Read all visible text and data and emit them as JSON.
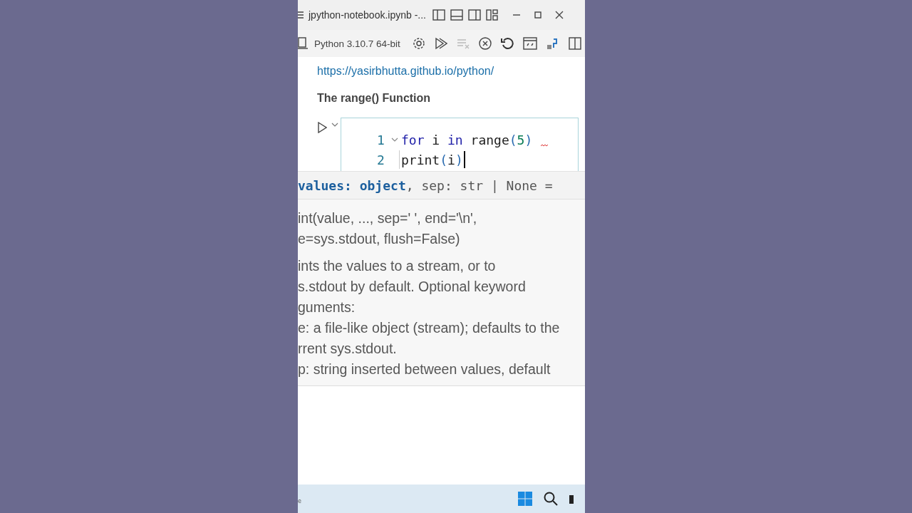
{
  "window": {
    "title": "jpython-notebook.ipynb -..."
  },
  "toolbar": {
    "kernel": "Python 3.10.7 64-bit"
  },
  "notebook": {
    "link": "https://yasirbhutta.github.io/python/",
    "heading": "The range() Function",
    "cell": {
      "lines": [
        {
          "number": "1",
          "tokens": [
            {
              "kind": "keyword",
              "text": "for"
            },
            {
              "kind": "plain",
              "text": " i "
            },
            {
              "kind": "keyword",
              "text": "in"
            },
            {
              "kind": "plain",
              "text": " range"
            },
            {
              "kind": "paren",
              "text": "("
            },
            {
              "kind": "number",
              "text": "5"
            },
            {
              "kind": "paren",
              "text": ")"
            }
          ]
        },
        {
          "number": "2",
          "tokens": [
            {
              "kind": "plain",
              "text": "print"
            },
            {
              "kind": "paren",
              "text": "("
            },
            {
              "kind": "plain",
              "text": "i"
            },
            {
              "kind": "paren",
              "text": ")"
            }
          ]
        }
      ]
    }
  },
  "hover": {
    "signature": [
      {
        "kind": "param",
        "text": "values: object"
      },
      {
        "kind": "plain",
        "text": ", sep: str | None ="
      }
    ],
    "code_lines": [
      "int(value, ..., sep=' ', end='\\n',",
      "e=sys.stdout, flush=False)"
    ],
    "doc_lines": [
      "ints the values to a stream, or to",
      "s.stdout by default. Optional keyword",
      "guments:",
      "e: a file-like object (stream); defaults to the",
      "rrent sys.stdout.",
      "p: string inserted between values, default"
    ]
  },
  "taskbar": {
    "text": "e"
  }
}
